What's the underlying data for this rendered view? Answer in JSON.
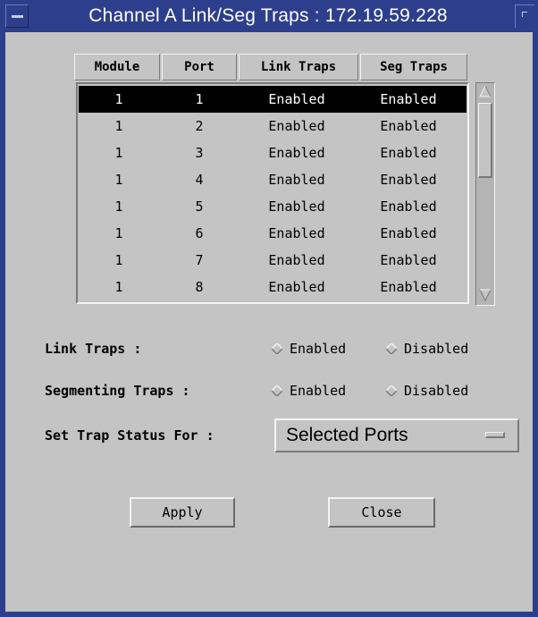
{
  "window": {
    "title": "Channel A Link/Seg Traps : 172.19.59.228"
  },
  "table": {
    "columns": {
      "module": "Module",
      "port": "Port",
      "link_traps": "Link Traps",
      "seg_traps": "Seg Traps"
    },
    "rows": [
      {
        "module": "1",
        "port": "1",
        "link": "Enabled",
        "seg": "Enabled",
        "selected": true
      },
      {
        "module": "1",
        "port": "2",
        "link": "Enabled",
        "seg": "Enabled",
        "selected": false
      },
      {
        "module": "1",
        "port": "3",
        "link": "Enabled",
        "seg": "Enabled",
        "selected": false
      },
      {
        "module": "1",
        "port": "4",
        "link": "Enabled",
        "seg": "Enabled",
        "selected": false
      },
      {
        "module": "1",
        "port": "5",
        "link": "Enabled",
        "seg": "Enabled",
        "selected": false
      },
      {
        "module": "1",
        "port": "6",
        "link": "Enabled",
        "seg": "Enabled",
        "selected": false
      },
      {
        "module": "1",
        "port": "7",
        "link": "Enabled",
        "seg": "Enabled",
        "selected": false
      },
      {
        "module": "1",
        "port": "8",
        "link": "Enabled",
        "seg": "Enabled",
        "selected": false
      }
    ]
  },
  "link_traps": {
    "label": "Link Traps :",
    "options": [
      "Enabled",
      "Disabled"
    ]
  },
  "segmenting_traps": {
    "label": "Segmenting Traps :",
    "options": [
      "Enabled",
      "Disabled"
    ]
  },
  "set_trap_status": {
    "label": "Set Trap Status For :",
    "selected": "Selected Ports"
  },
  "buttons": {
    "apply": "Apply",
    "close": "Close"
  },
  "colors": {
    "title_bar": "#2d3f8c",
    "background": "#c4c4c4",
    "selection": "#000000"
  }
}
